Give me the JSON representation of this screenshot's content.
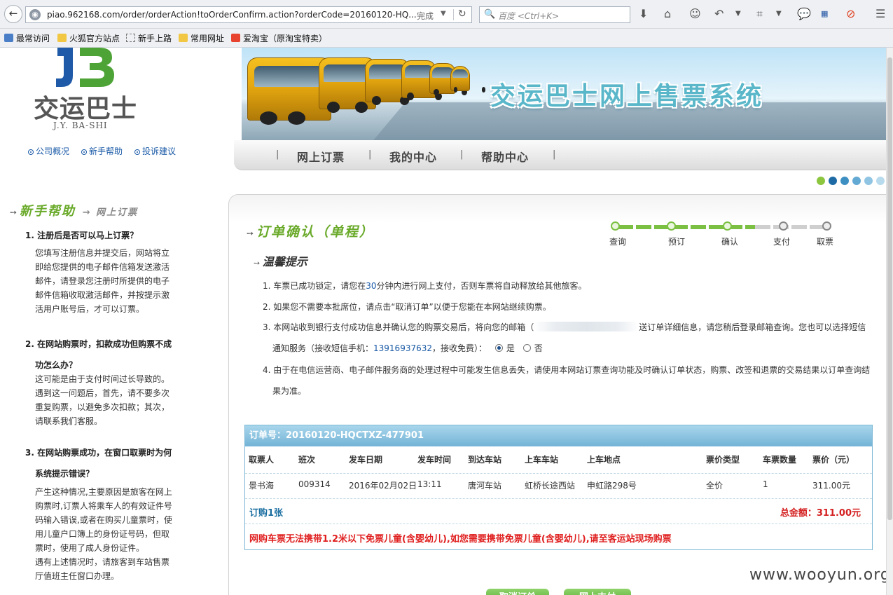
{
  "browser": {
    "url": "piao.962168.com/order/orderAction!toOrderConfirm.action?orderCode=20160120-HQ...",
    "load_status": "完成",
    "search_placeholder": "百度 <Ctrl+K>",
    "bookmarks": [
      {
        "label": "最常访问"
      },
      {
        "label": "火狐官方站点"
      },
      {
        "label": "新手上路"
      },
      {
        "label": "常用网址"
      },
      {
        "label": "爱淘宝（原淘宝特卖）"
      }
    ]
  },
  "header": {
    "logo_text": "交运巴士",
    "logo_sub": "J.Y. BA-SHI",
    "top_links": [
      "公司概况",
      "新手帮助",
      "投诉建议"
    ],
    "banner_title": "交运巴士网上售票系统",
    "nav": [
      "网上订票",
      "我的中心",
      "帮助中心"
    ]
  },
  "sidebar": {
    "title": "新手帮助",
    "subtitle": "网上订票",
    "faqs": [
      {
        "q": [
          "1. 注册后是否可以马上订票？"
        ],
        "a": [
          "您填写注册信息并提交后，网站将立",
          "即给您提供的电子邮件信箱发送激活",
          "邮件，请登录您注册时所提供的电子",
          "邮件信箱收取激活邮件，并按提示激",
          "活用户账号后，才可以订票。"
        ]
      },
      {
        "q": [
          "2. 在网站购票时，扣款成功但购票不成",
          "功怎么办？"
        ],
        "a": [
          "这可能是由于支付时间过长导致的。",
          "遇到这一问题后，首先，请不要多次",
          "重复购票，以避免多次扣款；其次，",
          "请联系我们客服。"
        ]
      },
      {
        "q": [
          "3. 在网站购票成功，在窗口取票时为何",
          "系统提示错误？"
        ],
        "a": [
          "产生这种情况,主要原因是旅客在网上",
          "购票时,订票人将乘车人的有效证件号",
          "码输入错误,或者在购买儿童票时，使",
          "用儿童户口簿上的身份证号码，但取",
          "票时，使用了成人身份证件。",
          "遇有上述情况时，请旅客到车站售票",
          "厅值班主任窗口办理。"
        ]
      }
    ]
  },
  "main": {
    "title": "订单确认（单程）",
    "steps": [
      "查询",
      "预订",
      "确认",
      "支付",
      "取票"
    ],
    "current_step": 3,
    "tips_title": "温馨提示",
    "tips": {
      "t1_pre": "1. 车票已成功锁定，请您在",
      "t1_num": "30",
      "t1_post": "分钟内进行网上支付，否则车票将自动释放给其他旅客。",
      "t2": "2. 如果您不需要本批席位，请点击“取消订单”以便于您能在本网站继续购票。",
      "t3_pre": "3. 本网站收到银行支付成功信息并确认您的购票交易后，将向您的邮箱（",
      "t3_post": "送订单详细信息，请您稍后登录邮箱查询。您也可以选择短信",
      "t3_line2_pre": "通知服务（接收短信手机：",
      "t3_phone": "13916937632",
      "t3_line2_post": "，接收免费）：",
      "t3_yes": "是",
      "t3_no": "否",
      "t4_line1": "4. 由于在电信运营商、电子邮件服务商的处理过程中可能发生信息丢失，请使用本网站订票查询功能及时确认订单状态，购票、改签和退票的交易结果以订单查询结",
      "t4_line2": "果为准。"
    },
    "order": {
      "header": "订单号：20160120-HQCTXZ-477901",
      "columns": [
        "取票人",
        "班次",
        "发车日期",
        "发车时间",
        "到达车站",
        "上车车站",
        "上车地点",
        "票价类型",
        "车票数量",
        "票价（元）"
      ],
      "row": [
        "景书海",
        "009314",
        "2016年02月02日",
        "13:11",
        "唐河车站",
        "虹桥长途西站",
        "申虹路298号",
        "全价",
        "1",
        "311.00元"
      ],
      "count": "订购1张",
      "total": "总金额：311.00元",
      "warning": "网购车票无法携带1.2米以下免票儿童(含婴幼儿),如您需要携带免票儿童(含婴幼儿),请至客运站现场购票"
    },
    "buttons": [
      "取消订单",
      "网上支付"
    ]
  },
  "watermark": "www.wooyun.org",
  "colors": {
    "accent_green": "#6aaa2a",
    "link_blue": "#1a5aa7",
    "alert_red": "#e02020",
    "table_header": "#73b3d6"
  }
}
